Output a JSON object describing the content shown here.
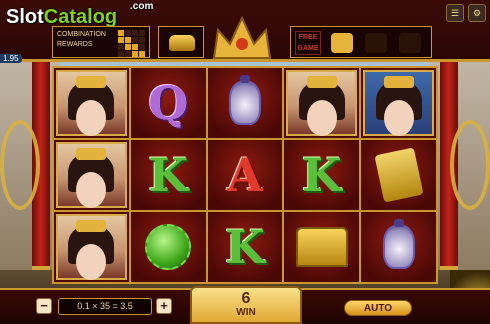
{
  "logo": {
    "slot": "Slot",
    "catalog": "Catalog",
    "com": ".com"
  },
  "top": {
    "combination_label": "COMBINATION",
    "rewards_label": "REWARDS",
    "combo_grid": [
      1,
      0,
      0,
      0,
      1,
      1,
      0,
      0,
      0,
      1,
      1,
      0,
      0,
      0,
      1,
      1
    ],
    "free_game_label": "FREE GAME",
    "left_badge": "1.95"
  },
  "reels": [
    [
      "lady-portrait",
      "letter-Q",
      "vase",
      "lady-portrait",
      "emperor-portrait"
    ],
    [
      "lady-portrait",
      "letter-K",
      "letter-A",
      "letter-K",
      "seal"
    ],
    [
      "lady-portrait",
      "jade-ring",
      "letter-K",
      "gold-ingots",
      "vase"
    ]
  ],
  "letters": {
    "Q": "Q",
    "K": "K",
    "A": "A"
  },
  "bottom": {
    "minus": "−",
    "bet_display": "0.1 × 35 = 3.5",
    "plus": "+",
    "win_amount": "6",
    "win_label": "WIN",
    "auto_label": "AUTO"
  },
  "colors": {
    "gold": "#c9962f",
    "reel_bg": "#8c1a10",
    "win_bg": "#f9e08a"
  }
}
